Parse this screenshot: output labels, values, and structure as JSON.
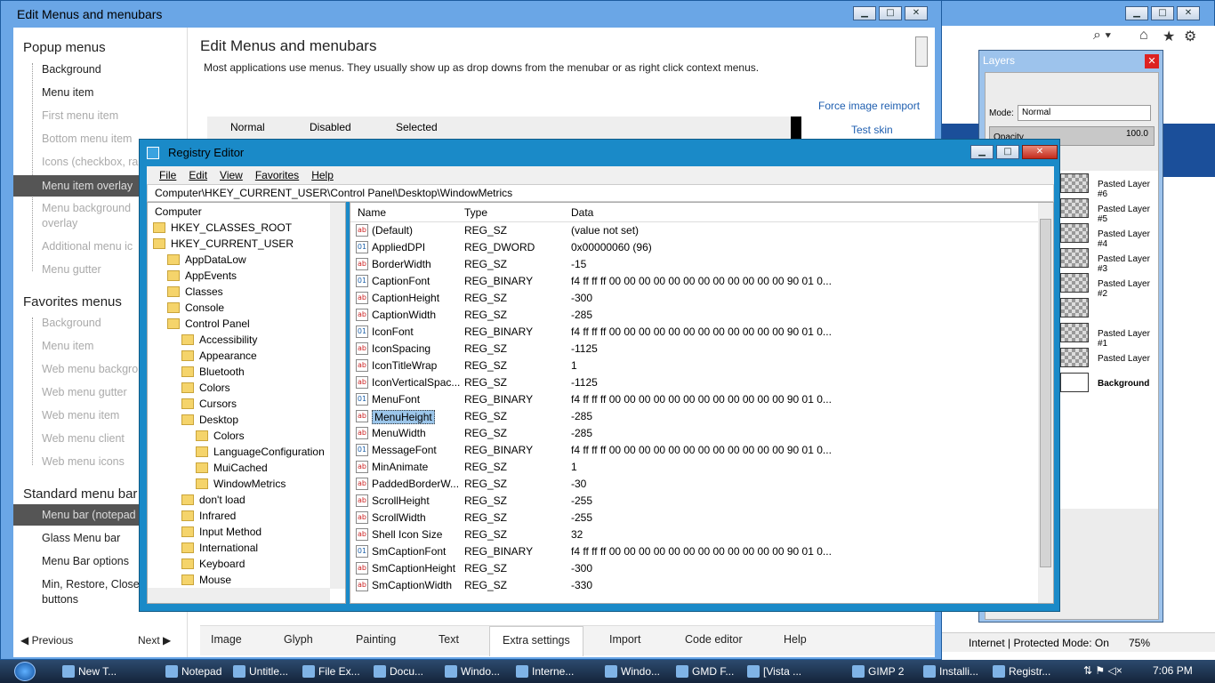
{
  "edit_window": {
    "title": "Edit Menus and menubars",
    "heading": "Edit Menus and menubars",
    "description": "Most applications use menus.  They usually show up as drop downs from the menubar or as right click context menus.",
    "force_reimport": "Force image reimport",
    "test_skin": "Test skin",
    "preview_cols": [
      "Normal",
      "Disabled",
      "Selected"
    ],
    "nav": {
      "popup_header": "Popup menus",
      "popup_items": [
        "Background",
        "Menu item",
        "First menu item",
        "Bottom menu item",
        "Icons (checkbox, ra",
        "Menu item overlay",
        "Menu background",
        "overlay",
        "Additional menu ic",
        "Menu gutter"
      ],
      "favorites_header": "Favorites menus",
      "favorites_items": [
        "Background",
        "Menu item",
        "Web menu backgro",
        "Web menu gutter",
        "Web menu item",
        "Web menu client",
        "Web menu icons"
      ],
      "standard_header": "Standard menu bar",
      "standard_items": [
        "Menu bar (notepad",
        "Glass Menu bar",
        "Menu Bar options",
        "Min, Restore, Close",
        "buttons"
      ],
      "previous": "Previous",
      "next": "Next"
    },
    "tabs": [
      "Image",
      "Glyph",
      "Painting",
      "Text",
      "Extra settings",
      "Import",
      "Code editor",
      "Help"
    ]
  },
  "layers": {
    "title": "Layers",
    "mode_label": "Mode:",
    "mode_value": "Normal",
    "opacity_label": "Opacity",
    "opacity_value": "100.0",
    "items": [
      "Pasted Layer #6",
      "Pasted Layer #5",
      "Pasted Layer #4",
      "Pasted Layer #3",
      "Pasted Layer #2",
      "",
      "Pasted Layer #1",
      "Pasted Layer",
      "Background"
    ]
  },
  "ie_status": {
    "zone": "Internet | Protected Mode: On",
    "zoom": "75%"
  },
  "registry": {
    "title": "Registry Editor",
    "menu": [
      "File",
      "Edit",
      "View",
      "Favorites",
      "Help"
    ],
    "address": "Computer\\HKEY_CURRENT_USER\\Control Panel\\Desktop\\WindowMetrics",
    "tree": [
      {
        "label": "Computer"
      },
      {
        "label": "HKEY_CLASSES_ROOT"
      },
      {
        "label": "HKEY_CURRENT_USER"
      },
      {
        "label": "AppDataLow"
      },
      {
        "label": "AppEvents"
      },
      {
        "label": "Classes"
      },
      {
        "label": "Console"
      },
      {
        "label": "Control Panel"
      },
      {
        "label": "Accessibility"
      },
      {
        "label": "Appearance"
      },
      {
        "label": "Bluetooth"
      },
      {
        "label": "Colors"
      },
      {
        "label": "Cursors"
      },
      {
        "label": "Desktop"
      },
      {
        "label": "Colors"
      },
      {
        "label": "LanguageConfiguration"
      },
      {
        "label": "MuiCached"
      },
      {
        "label": "WindowMetrics"
      },
      {
        "label": "don't load"
      },
      {
        "label": "Infrared"
      },
      {
        "label": "Input Method"
      },
      {
        "label": "International"
      },
      {
        "label": "Keyboard"
      },
      {
        "label": "Mouse"
      }
    ],
    "columns": [
      "Name",
      "Type",
      "Data"
    ],
    "values": [
      {
        "name": "(Default)",
        "type": "REG_SZ",
        "data": "(value not set)",
        "icon": "ab"
      },
      {
        "name": "AppliedDPI",
        "type": "REG_DWORD",
        "data": "0x00000060 (96)",
        "icon": "bin"
      },
      {
        "name": "BorderWidth",
        "type": "REG_SZ",
        "data": "-15",
        "icon": "ab"
      },
      {
        "name": "CaptionFont",
        "type": "REG_BINARY",
        "data": "f4 ff ff ff 00 00 00 00 00 00 00 00 00 00 00 00 90 01 0...",
        "icon": "bin"
      },
      {
        "name": "CaptionHeight",
        "type": "REG_SZ",
        "data": "-300",
        "icon": "ab"
      },
      {
        "name": "CaptionWidth",
        "type": "REG_SZ",
        "data": "-285",
        "icon": "ab"
      },
      {
        "name": "IconFont",
        "type": "REG_BINARY",
        "data": "f4 ff ff ff 00 00 00 00 00 00 00 00 00 00 00 00 90 01 0...",
        "icon": "bin"
      },
      {
        "name": "IconSpacing",
        "type": "REG_SZ",
        "data": "-1125",
        "icon": "ab"
      },
      {
        "name": "IconTitleWrap",
        "type": "REG_SZ",
        "data": "1",
        "icon": "ab"
      },
      {
        "name": "IconVerticalSpac...",
        "type": "REG_SZ",
        "data": "-1125",
        "icon": "ab"
      },
      {
        "name": "MenuFont",
        "type": "REG_BINARY",
        "data": "f4 ff ff ff 00 00 00 00 00 00 00 00 00 00 00 00 90 01 0...",
        "icon": "bin"
      },
      {
        "name": "MenuHeight",
        "type": "REG_SZ",
        "data": "-285",
        "icon": "ab"
      },
      {
        "name": "MenuWidth",
        "type": "REG_SZ",
        "data": "-285",
        "icon": "ab"
      },
      {
        "name": "MessageFont",
        "type": "REG_BINARY",
        "data": "f4 ff ff ff 00 00 00 00 00 00 00 00 00 00 00 00 90 01 0...",
        "icon": "bin"
      },
      {
        "name": "MinAnimate",
        "type": "REG_SZ",
        "data": "1",
        "icon": "ab"
      },
      {
        "name": "PaddedBorderW...",
        "type": "REG_SZ",
        "data": "-30",
        "icon": "ab"
      },
      {
        "name": "ScrollHeight",
        "type": "REG_SZ",
        "data": "-255",
        "icon": "ab"
      },
      {
        "name": "ScrollWidth",
        "type": "REG_SZ",
        "data": "-255",
        "icon": "ab"
      },
      {
        "name": "Shell Icon Size",
        "type": "REG_SZ",
        "data": "32",
        "icon": "ab"
      },
      {
        "name": "SmCaptionFont",
        "type": "REG_BINARY",
        "data": "f4 ff ff ff 00 00 00 00 00 00 00 00 00 00 00 00 90 01 0...",
        "icon": "bin"
      },
      {
        "name": "SmCaptionHeight",
        "type": "REG_SZ",
        "data": "-300",
        "icon": "ab"
      },
      {
        "name": "SmCaptionWidth",
        "type": "REG_SZ",
        "data": "-330",
        "icon": "ab"
      }
    ],
    "selected_value": "MenuHeight"
  },
  "taskbar": {
    "items": [
      "New T...",
      "Notepad",
      "Untitle...",
      "File Ex...",
      "Docu...",
      "Windo...",
      "Interne...",
      "Windo...",
      "GMD F...",
      "[Vista ...",
      "GIMP 2",
      "Installi...",
      "Registr..."
    ],
    "time": "7:06 PM"
  }
}
